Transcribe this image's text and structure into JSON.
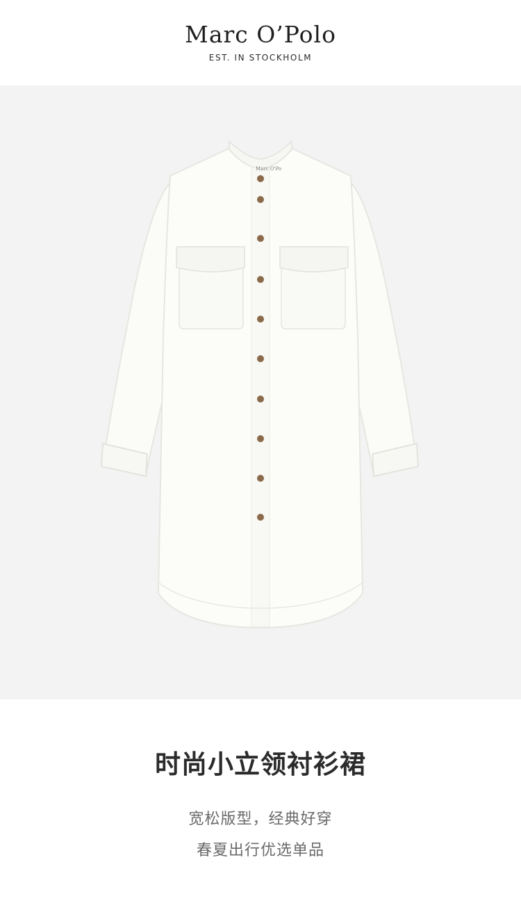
{
  "brand": {
    "name": "Marc O’Polo",
    "tagline": "EST. IN STOCKHOLM"
  },
  "product": {
    "image_subject": "white stand-collar long shirt dress with chest flap pockets and tortoiseshell buttons",
    "title": "时尚小立领衬衫裙",
    "description_lines": [
      "宽松版型，经典好穿",
      "春夏出行优选单品"
    ]
  },
  "colors": {
    "background": "#ffffff",
    "image_background": "#f3f3f3",
    "garment": "#fafaf7",
    "button": "#8a6a4a",
    "title_text": "#2b2b2b",
    "desc_text": "#6a6a6a"
  }
}
